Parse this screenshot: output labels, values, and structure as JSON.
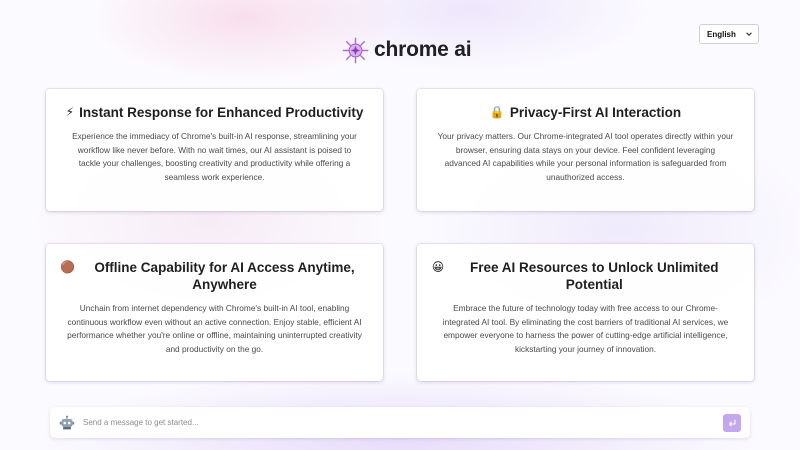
{
  "language": {
    "selected": "English"
  },
  "brand": {
    "name": "chrome ai"
  },
  "cards": [
    {
      "emoji": "⚡",
      "title": "Instant Response for Enhanced Productivity",
      "body": "Experience the immediacy of Chrome's built-in AI response, streamlining your workflow like never before. With no wait times, our AI assistant is poised to tackle your challenges, boosting creativity and productivity while offering a seamless work experience."
    },
    {
      "emoji": "🔒",
      "title": "Privacy-First AI Interaction",
      "body": "Your privacy matters. Our Chrome-integrated AI tool operates directly within your browser, ensuring data stays on your device. Feel confident leveraging advanced AI capabilities while your personal information is safeguarded from unauthorized access."
    },
    {
      "emoji": "🟤",
      "title": "Offline Capability for AI Access Anytime, Anywhere",
      "body": "Unchain from internet dependency with Chrome's built-in AI tool, enabling continuous workflow even without an active connection. Enjoy stable, efficient AI performance whether you're online or offline, maintaining uninterrupted creativity and productivity on the go."
    },
    {
      "emoji": "😀",
      "title": "Free AI Resources to Unlock Unlimited Potential",
      "body": "Embrace the future of technology today with free access to our Chrome-integrated AI tool. By eliminating the cost barriers of traditional AI services, we empower everyone to harness the power of cutting-edge artificial intelligence, kickstarting your journey of innovation."
    }
  ],
  "chat": {
    "placeholder": "Send a message to get started...",
    "send_icon": "enter-arrow-icon",
    "avatar_icon": "robot-icon"
  },
  "colors": {
    "accent": "#c4a8ee",
    "logo": "#b06fd6"
  }
}
